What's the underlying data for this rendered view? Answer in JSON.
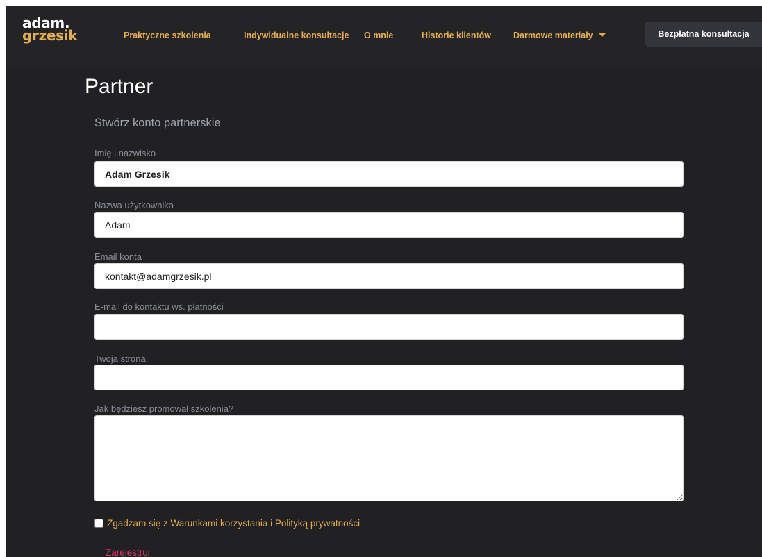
{
  "brand": {
    "line1": "adam.",
    "line2": "grzesik"
  },
  "nav": {
    "items": [
      {
        "label": "Praktyczne szkolenia"
      },
      {
        "label": "Indywidualne konsultacje"
      },
      {
        "label": "O mnie"
      },
      {
        "label": "Historie klientów"
      },
      {
        "label": "Darmowe materiały"
      }
    ],
    "cta_label": "Bezpłatna konsultacja"
  },
  "page": {
    "title": "Partner",
    "subtitle": "Stwórz konto partnerskie"
  },
  "form": {
    "full_name": {
      "label": "Imię i nazwisko",
      "value": "Adam Grzesik"
    },
    "username": {
      "label": "Nazwa użytkownika",
      "value": "Adam"
    },
    "account_email": {
      "label": "Email konta",
      "value": "kontakt@adamgrzesik.pl"
    },
    "payment_email": {
      "label": "E-mail do kontaktu ws. płatności",
      "value": ""
    },
    "website": {
      "label": "Twoja strona",
      "value": ""
    },
    "promotion": {
      "label": "Jak będziesz promował szkolenia?",
      "value": ""
    },
    "consent_label": "Zgadzam się z Warunkami korzystania i Polityką prywatności",
    "consent_checked": false,
    "submit_label": "Zarejestruj"
  },
  "colors": {
    "background": "#212124",
    "navbar": "#242427",
    "accent": "#e5ad4e",
    "label": "#8a8f99",
    "link": "#e0356a",
    "cta_bg": "#34353b"
  }
}
